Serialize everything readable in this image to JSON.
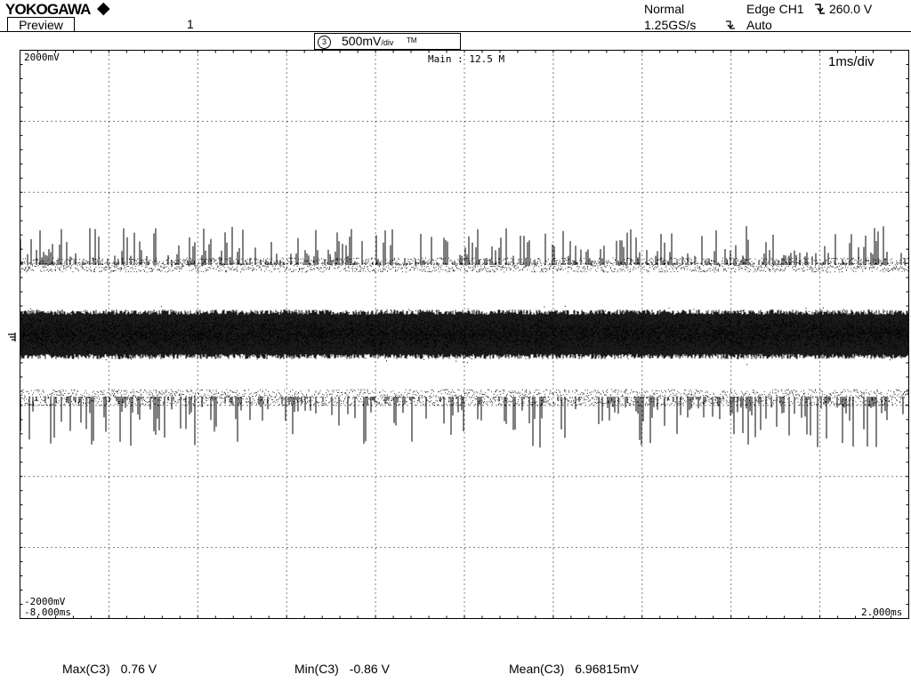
{
  "header": {
    "brand": "YOKOGAWA",
    "preview_label": "Preview",
    "record_number": "1",
    "acq_mode": "Normal",
    "sample_rate": "1.25GS/s",
    "trigger_type": "Edge CH1",
    "trigger_level": "260.0 V",
    "trigger_mode": "Auto"
  },
  "channel": {
    "number": "3",
    "volts": "500mV",
    "per_div": "/div",
    "tm": "TM"
  },
  "screen": {
    "top_volt_label": "2000mV",
    "bottom_volt_label": "-2000mV",
    "main_label": "Main : 12.5 M",
    "timebase": "1ms/div",
    "time_left": "-8.000ms",
    "time_right": "2.000ms"
  },
  "measurements": [
    {
      "name": "Max(C3)",
      "value": "0.76 V"
    },
    {
      "name": "Min(C3)",
      "value": "-0.86 V"
    },
    {
      "name": "Mean(C3)",
      "value": "6.96815mV"
    }
  ],
  "colors": {
    "trace": "#000000",
    "grid": "#000000",
    "background": "#ffffff"
  },
  "icons": {
    "brand_mark": "diamond-icon",
    "trigger_edge": "falling-edge-icon",
    "ground_marker": "ground-icon"
  }
}
